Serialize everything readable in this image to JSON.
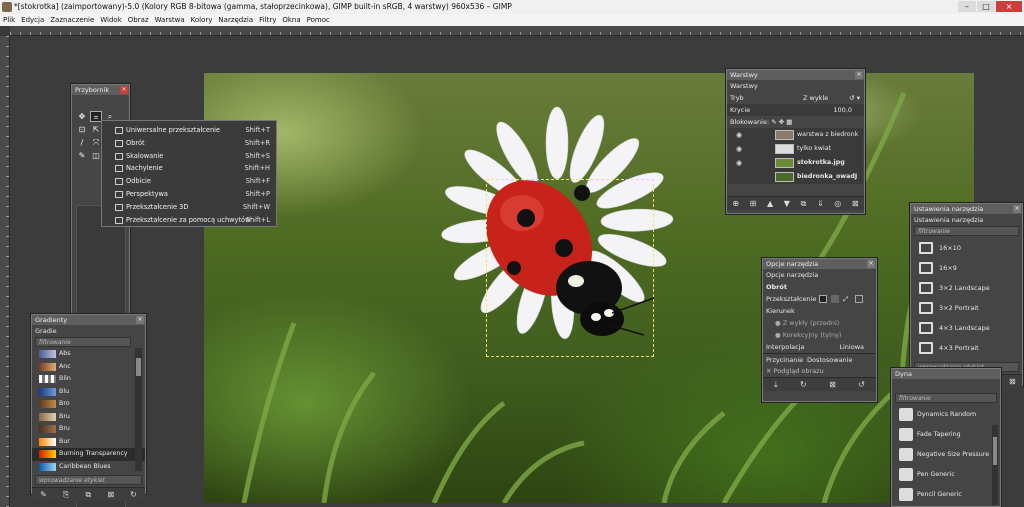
{
  "window": {
    "title": "*[stokrotka] (zaimportowany)-5.0 (Kolory RGB 8-bitowa (gamma, stałoprzecinkowa), GIMP built-in sRGB, 4 warstwy) 960x536 – GIMP",
    "controls": [
      "–",
      "□",
      "×"
    ]
  },
  "menubar": [
    "Plik",
    "Edycja",
    "Zaznaczenie",
    "Widok",
    "Obraz",
    "Warstwa",
    "Kolory",
    "Narzędzia",
    "Filtry",
    "Okna",
    "Pomoc"
  ],
  "toolbox": {
    "title": "Przybornik",
    "tools": [
      "✥",
      "⌗",
      "⌕",
      "⊡",
      "⇱",
      "▢",
      "/",
      "⤧",
      "A",
      "✎",
      "◫",
      "▤"
    ]
  },
  "transform_menu": {
    "items": [
      {
        "label": "Uniwersalne przekształcenie",
        "shortcut": "Shift+T"
      },
      {
        "label": "Obrót",
        "shortcut": "Shift+R"
      },
      {
        "label": "Skalowanie",
        "shortcut": "Shift+S"
      },
      {
        "label": "Nachylenie",
        "shortcut": "Shift+H"
      },
      {
        "label": "Odbicie",
        "shortcut": "Shift+F"
      },
      {
        "label": "Perspektywa",
        "shortcut": "Shift+P"
      },
      {
        "label": "Przekształcenie 3D",
        "shortcut": "Shift+W"
      },
      {
        "label": "Przekształcenie za pomocą uchwytów",
        "shortcut": "Shift+L"
      }
    ]
  },
  "gradients": {
    "title": "Gradienty",
    "tab": "Gradie",
    "filter_placeholder": "filtrowanie",
    "items": [
      {
        "label": "Abs",
        "colors": [
          "#4a5a9a",
          "#c0c4e0"
        ]
      },
      {
        "label": "Anc",
        "colors": [
          "#7a3a2a",
          "#d8b070"
        ]
      },
      {
        "label": "Blin",
        "colors": [
          "#ffffff",
          "#777777"
        ]
      },
      {
        "label": "Blu",
        "colors": [
          "#1a3a8a",
          "#6a9ad8"
        ]
      },
      {
        "label": "Bro",
        "colors": [
          "#5a3a1a",
          "#c08a4a"
        ]
      },
      {
        "label": "Bru",
        "colors": [
          "#8a6a4a",
          "#e0d0b0"
        ]
      },
      {
        "label": "Bru",
        "colors": [
          "#4a3020",
          "#a07050"
        ]
      },
      {
        "label": "Bur",
        "colors": [
          "#ff8800",
          "#ffffff"
        ]
      },
      {
        "label": "Burning Transparency",
        "colors": [
          "#d02000",
          "#ffcc00"
        ]
      },
      {
        "label": "Caribbean Blues",
        "colors": [
          "#0a5aaa",
          "#9ad8f0"
        ]
      }
    ],
    "tag_placeholder": "wprowadzanie etykiet",
    "buttons": [
      "✎",
      "⎘",
      "⧉",
      "⊠",
      "↻"
    ]
  },
  "layers": {
    "title": "Warstwy",
    "tab": "Warstwy",
    "mode_label": "Tryb",
    "mode_value": "Z wykle",
    "opacity_label": "Krycie",
    "opacity_value": "100,0",
    "lock_label": "Blokowanie:",
    "items": [
      {
        "name": "warstwa z biedronk",
        "visible": true,
        "thumb": "#8a7a6a"
      },
      {
        "name": "tylko kwiat",
        "visible": true,
        "thumb": "#dddddd"
      },
      {
        "name": "stokrotka.jpg",
        "visible": true,
        "thumb": "#6a8a3a"
      },
      {
        "name": "biedronka_owadJ",
        "visible": false,
        "thumb": "#4a6a2a"
      }
    ],
    "buttons": [
      "⊕",
      "⊞",
      "▲",
      "▼",
      "⧉",
      "⇓",
      "◎",
      "⊠"
    ]
  },
  "tool_options": {
    "title": "Opcje narzędzia",
    "tab": "Opcje narzędzia",
    "tool_name": "Obrót",
    "transform_label": "Przekształcenie",
    "direction_label": "Kierunek",
    "dir_normal": "Z wykły (przedni)",
    "dir_corrective": "Korekcyjny (tylny)",
    "interpolation_label": "Interpolacja",
    "interpolation_value": "Liniowa",
    "clipping_label": "Przycinanie",
    "clipping_value": "Dostosowanie",
    "preview_label": "Podgląd obrazu",
    "buttons": [
      "⤓",
      "↻",
      "⊠",
      "↺"
    ]
  },
  "tool_settings": {
    "title": "Ustawienia narzędzia",
    "tab": "Ustawienia narzędzia",
    "filter_placeholder": "filtrowanie",
    "items": [
      "16×10",
      "16×9",
      "3×2 Landscape",
      "3×2 Portrait",
      "4×3 Landscape",
      "4×3 Portrait"
    ],
    "tag_placeholder": "wprowadzanie etykiet",
    "buttons": [
      "✎",
      "⎘",
      "⤒",
      "⊠",
      "↺",
      "⊠"
    ]
  },
  "dynamics": {
    "title": "Dyna",
    "filter_placeholder": "filtrowanie",
    "items": [
      "Dynamics Random",
      "Fade Tapering",
      "Negative Size Pressure",
      "Pen Generic",
      "Pencil Generic"
    ]
  }
}
